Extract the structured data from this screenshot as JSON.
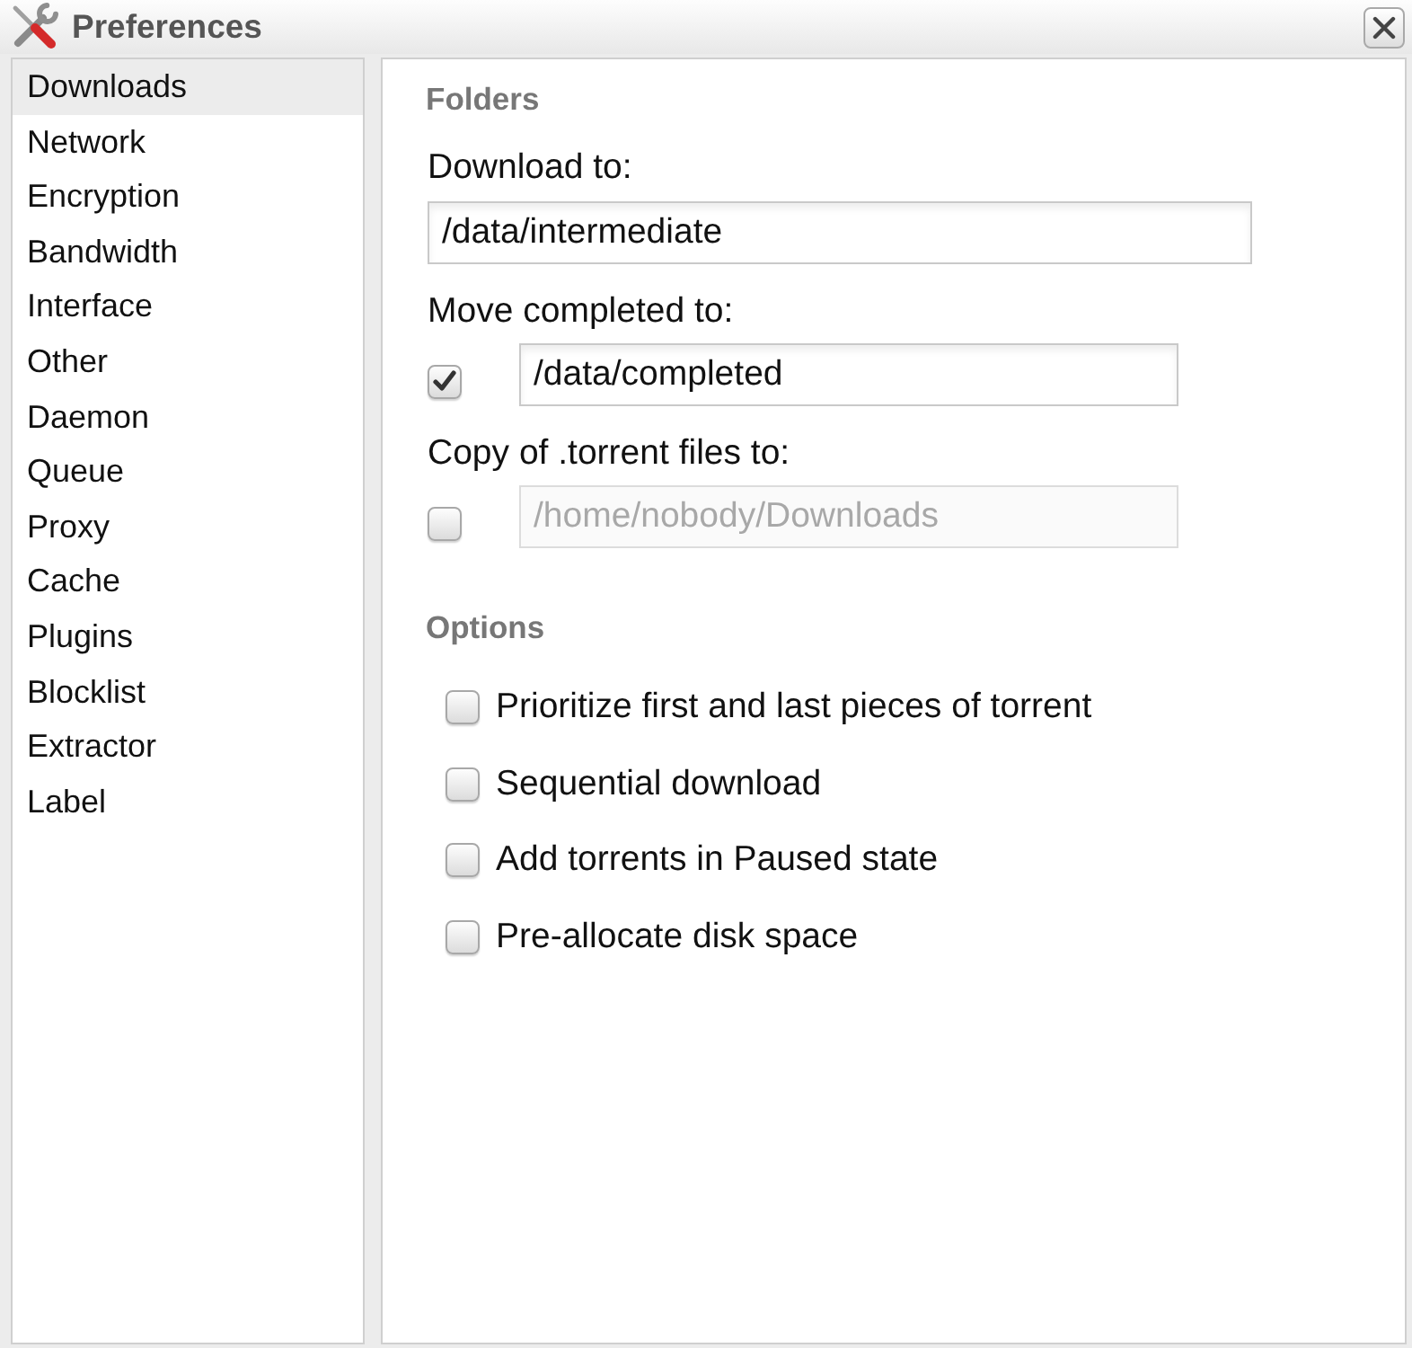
{
  "window": {
    "title": "Preferences"
  },
  "sidebar": {
    "items": [
      {
        "label": "Downloads",
        "selected": true
      },
      {
        "label": "Network",
        "selected": false
      },
      {
        "label": "Encryption",
        "selected": false
      },
      {
        "label": "Bandwidth",
        "selected": false
      },
      {
        "label": "Interface",
        "selected": false
      },
      {
        "label": "Other",
        "selected": false
      },
      {
        "label": "Daemon",
        "selected": false
      },
      {
        "label": "Queue",
        "selected": false
      },
      {
        "label": "Proxy",
        "selected": false
      },
      {
        "label": "Cache",
        "selected": false
      },
      {
        "label": "Plugins",
        "selected": false
      },
      {
        "label": "Blocklist",
        "selected": false
      },
      {
        "label": "Extractor",
        "selected": false
      },
      {
        "label": "Label",
        "selected": false
      }
    ]
  },
  "folders": {
    "title": "Folders",
    "fields": [
      {
        "kind": "text",
        "label": "Download to:",
        "value": "/data/intermediate",
        "disabled": false
      },
      {
        "kind": "toggle",
        "label": "Move completed to:",
        "checked": true,
        "value": "/data/completed",
        "disabled": false
      },
      {
        "kind": "toggle",
        "label": "Copy of .torrent files to:",
        "checked": false,
        "value": "/home/nobody/Downloads",
        "disabled": true
      }
    ]
  },
  "options": {
    "title": "Options",
    "items": [
      {
        "label": "Prioritize first and last pieces of torrent",
        "checked": false
      },
      {
        "label": "Sequential download",
        "checked": false
      },
      {
        "label": "Add torrents in Paused state",
        "checked": false
      },
      {
        "label": "Pre-allocate disk space",
        "checked": false
      }
    ]
  }
}
